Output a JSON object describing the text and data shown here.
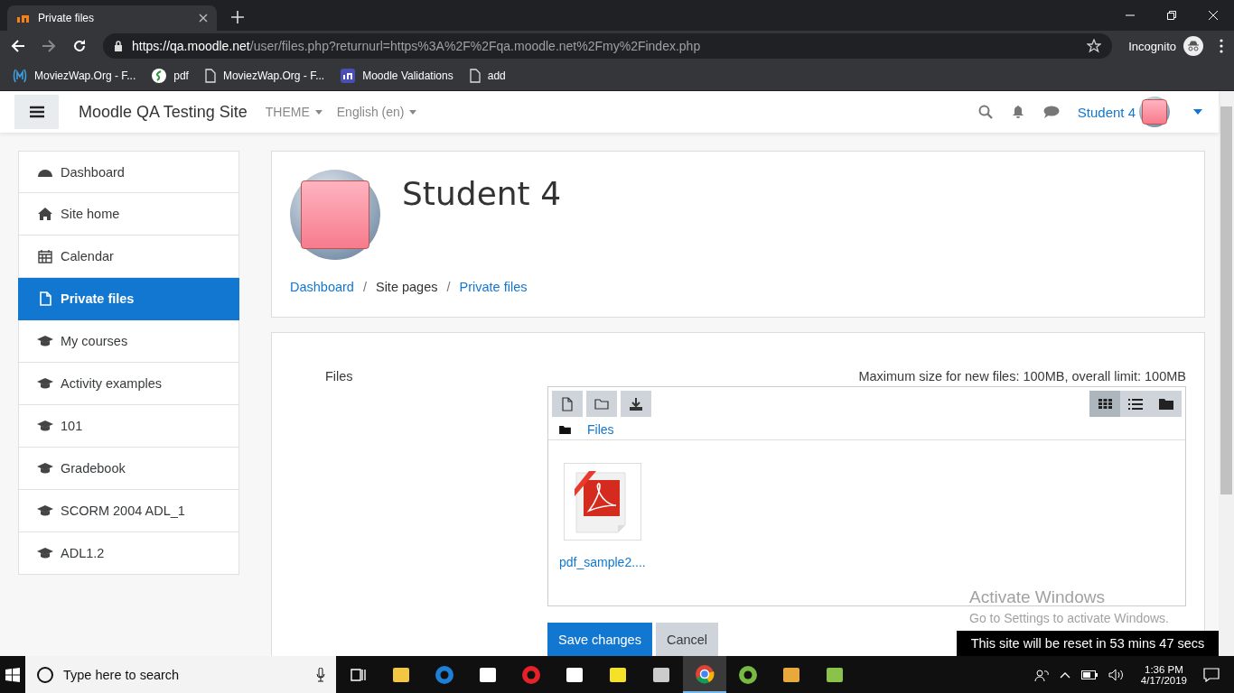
{
  "browser": {
    "tab_title": "Private files",
    "url_host": "https://qa.moodle.net",
    "url_path": "/user/files.php?returnurl=https%3A%2F%2Fqa.moodle.net%2Fmy%2Findex.php",
    "profile_label": "Incognito",
    "bookmarks": [
      {
        "kind": "m",
        "label": "MoviezWap.Org - F..."
      },
      {
        "kind": "green",
        "label": "pdf"
      },
      {
        "kind": "page",
        "label": "MoviezWap.Org - F..."
      },
      {
        "kind": "moodle",
        "label": "Moodle Validations"
      },
      {
        "kind": "page",
        "label": "add"
      }
    ]
  },
  "site": {
    "name": "Moodle QA Testing Site",
    "menus": [
      "THEME",
      "English (en)"
    ],
    "user_name": "Student 4"
  },
  "nav": [
    {
      "kind": "dashboard",
      "label": "Dashboard",
      "selected": false
    },
    {
      "kind": "home",
      "label": "Site home",
      "selected": false
    },
    {
      "kind": "calendar",
      "label": "Calendar",
      "selected": false
    },
    {
      "kind": "file",
      "label": "Private files",
      "selected": true
    },
    {
      "kind": "course",
      "label": "My courses",
      "selected": false
    },
    {
      "kind": "course",
      "label": "Activity examples",
      "selected": false
    },
    {
      "kind": "course",
      "label": "101",
      "selected": false
    },
    {
      "kind": "course",
      "label": "Gradebook",
      "selected": false
    },
    {
      "kind": "course",
      "label": "SCORM 2004 ADL_1",
      "selected": false
    },
    {
      "kind": "course",
      "label": "ADL1.2",
      "selected": false
    }
  ],
  "profile": {
    "name": "Student 4",
    "separator": "/",
    "breadcrumbs": [
      {
        "label": "Dashboard",
        "link": true
      },
      {
        "label": "Site pages",
        "link": false
      },
      {
        "label": "Private files",
        "link": true
      }
    ]
  },
  "files": {
    "label": "Files",
    "limits": "Maximum size for new files: 100MB, overall limit: 100MB",
    "path": "Files",
    "views": [
      {
        "kind": "grid",
        "selected": true
      },
      {
        "kind": "list",
        "selected": false
      },
      {
        "kind": "tree",
        "selected": false
      }
    ],
    "items": [
      {
        "name": "pdf_sample2...."
      }
    ],
    "buttons": [
      {
        "label": "Save changes",
        "kind": "primary"
      },
      {
        "label": "Cancel",
        "kind": "secondary"
      }
    ]
  },
  "activation": {
    "title": "Activate Windows",
    "subtitle": "Go to Settings to activate Windows."
  },
  "reset_notice": "This site will be reset in 53 mins 47 secs",
  "taskbar": {
    "search_placeholder": "Type here to search",
    "time": "1:36 PM",
    "date": "4/17/2019",
    "apps": [
      {
        "kind": "taskview",
        "selected": false
      },
      {
        "kind": "explorer",
        "selected": false
      },
      {
        "kind": "edge",
        "selected": false
      },
      {
        "kind": "store",
        "selected": false
      },
      {
        "kind": "opera",
        "selected": false
      },
      {
        "kind": "mail",
        "selected": false
      },
      {
        "kind": "notes",
        "selected": false
      },
      {
        "kind": "network",
        "selected": false
      },
      {
        "kind": "chrome",
        "selected": true
      },
      {
        "kind": "torrent",
        "selected": false
      },
      {
        "kind": "paint",
        "selected": false
      },
      {
        "kind": "chart",
        "selected": false
      }
    ]
  }
}
